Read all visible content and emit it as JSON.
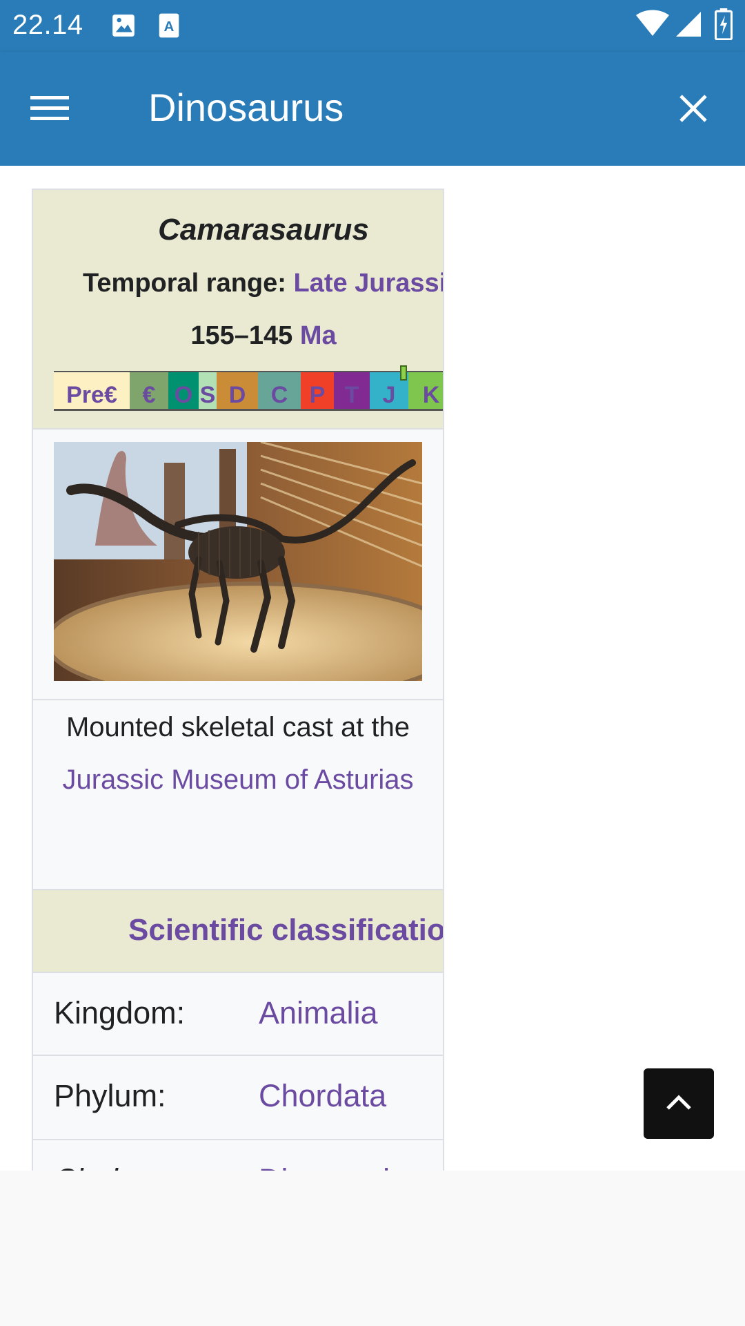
{
  "status_bar": {
    "time": "22.14",
    "icons": [
      "image-notification-icon",
      "text-notification-icon",
      "wifi-icon",
      "signal-icon",
      "battery-icon"
    ]
  },
  "app_bar": {
    "title": "Dinosaurus",
    "menu_icon": "hamburger-menu-icon",
    "close_icon": "close-icon"
  },
  "infobox": {
    "taxon": "Camarasaurus",
    "temporal_label": "Temporal range: ",
    "temporal_link": "Late Jurassic",
    "range_value": "155–145 ",
    "range_unit": "Ma",
    "timeline": [
      {
        "label": "Pre€",
        "color": "#fdf0c2"
      },
      {
        "label": "€",
        "color": "#7fa56c"
      },
      {
        "label": "O",
        "color": "#009270"
      },
      {
        "label": "S",
        "color": "#b3e1b6"
      },
      {
        "label": "D",
        "color": "#cb8c37"
      },
      {
        "label": "C",
        "color": "#67a599"
      },
      {
        "label": "P",
        "color": "#f04028"
      },
      {
        "label": "T",
        "color": "#812b92"
      },
      {
        "label": "J",
        "color": "#34b2c9"
      },
      {
        "label": "K",
        "color": "#7fc64e"
      }
    ],
    "image_alt": "Camarasaurus mounted skeleton",
    "caption_text": "Mounted skeletal cast at the ",
    "caption_link": "Jurassic Museum of Asturias",
    "classification_header": "Scientific classification",
    "rows": [
      {
        "label": "Kingdom:",
        "value": "Animalia"
      },
      {
        "label": "Phylum:",
        "value": "Chordata"
      },
      {
        "label": "Clade:",
        "value": "Dinosauria"
      }
    ]
  },
  "fab": {
    "icon": "chevron-up-icon"
  },
  "colors": {
    "primary": "#2a7cb8",
    "link": "#6b4ba1",
    "header_bg": "#eaead3"
  }
}
